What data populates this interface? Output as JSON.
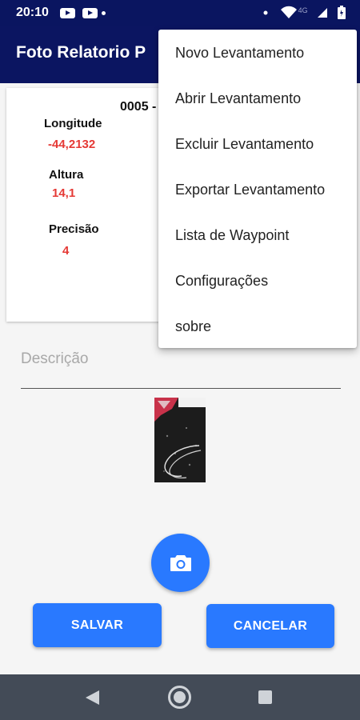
{
  "status_bar": {
    "time": "20:10",
    "network": "4G"
  },
  "app_bar": {
    "title": "Foto Relatorio P"
  },
  "record": {
    "id": "0005 -",
    "longitude_label": "Longitude",
    "longitude_value": "-44,2132",
    "altura_label": "Altura",
    "altura_value": "14,1",
    "precisao_label": "Precisão",
    "precisao_value": "4"
  },
  "form": {
    "descricao_hint": "Descrição"
  },
  "buttons": {
    "save_label": "SALVAR",
    "cancel_label": "CANCELAR"
  },
  "overflow_menu": {
    "items": [
      {
        "label": "Novo Levantamento"
      },
      {
        "label": "Abrir Levantamento"
      },
      {
        "label": "Excluir Levantamento"
      },
      {
        "label": "Exportar Levantamento"
      },
      {
        "label": "Lista de Waypoint"
      },
      {
        "label": "Configurações"
      },
      {
        "label": "sobre"
      }
    ]
  },
  "colors": {
    "app_bar": "#0b1561",
    "accent": "#2979ff",
    "value_text": "#e53935",
    "nav_bar": "#434b57"
  },
  "icons": {
    "fab": "camera-icon",
    "nav_back": "back-triangle-icon",
    "nav_home": "home-circle-icon",
    "nav_recent": "recents-square-icon"
  }
}
